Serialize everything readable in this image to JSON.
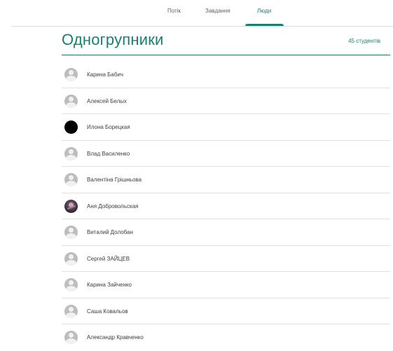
{
  "nav": {
    "tabs": [
      {
        "label": "Потік",
        "active": false
      },
      {
        "label": "Завдання",
        "active": false
      },
      {
        "label": "Люди",
        "active": true
      }
    ]
  },
  "section": {
    "title": "Одногрупники",
    "count": "45 студентів"
  },
  "students": [
    {
      "name": "Карина Бабич",
      "avatar": "default-avatar-icon"
    },
    {
      "name": "Алексей Белых",
      "avatar": "default-avatar-icon"
    },
    {
      "name": "Илона Борецкая",
      "avatar": "black-avatar"
    },
    {
      "name": "Влад Василенко",
      "avatar": "default-avatar-icon"
    },
    {
      "name": "Валентіна Грішньова",
      "avatar": "default-avatar-icon"
    },
    {
      "name": "Аня Добровольская",
      "avatar": "photo-avatar"
    },
    {
      "name": "Виталий Долобан",
      "avatar": "default-avatar-icon"
    },
    {
      "name": "Сергей ЗАЙЦЕВ",
      "avatar": "default-avatar-icon"
    },
    {
      "name": "Карина Зайченко",
      "avatar": "default-avatar-icon"
    },
    {
      "name": "Саша Ковальов",
      "avatar": "default-avatar-icon"
    },
    {
      "name": "Александр Кравченко",
      "avatar": "default-avatar-icon"
    }
  ],
  "colors": {
    "accent": "#1a7f73",
    "divider": "#e0e0e0",
    "avatar_default": "#bdbdbd"
  }
}
